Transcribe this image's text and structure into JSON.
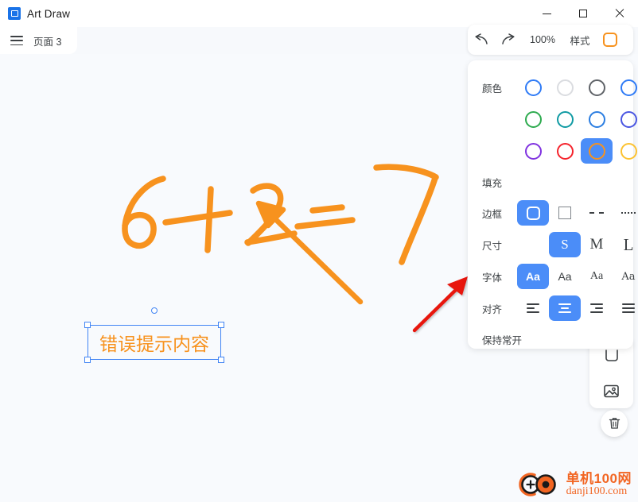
{
  "window": {
    "app_title": "Art Draw",
    "app_icon": "picture-icon",
    "controls": {
      "minimize": "minimize-icon",
      "maximize": "maximize-icon",
      "close": "close-icon"
    }
  },
  "tabbar": {
    "menu_icon": "hamburger-menu-icon",
    "tab_label": "页面 3"
  },
  "toolbar": {
    "undo_icon": "undo-arrow-icon",
    "redo_icon": "redo-arrow-icon",
    "zoom_level": "100%",
    "style_label": "样式",
    "style_swatch_color": "#f7921e"
  },
  "panel": {
    "color": {
      "label": "颜色",
      "swatches": [
        {
          "name": "blue",
          "hex": "#2f7bf6",
          "selected": false
        },
        {
          "name": "light-gray",
          "hex": "#dadce0",
          "selected": false
        },
        {
          "name": "dark-gray",
          "hex": "#5f6368",
          "selected": false
        },
        {
          "name": "royal-blue",
          "hex": "#2f7bf6",
          "selected": false
        },
        {
          "name": "green",
          "hex": "#2eab4f",
          "selected": false
        },
        {
          "name": "teal",
          "hex": "#0f9aa3",
          "selected": false
        },
        {
          "name": "azure",
          "hex": "#2a7de1",
          "selected": false
        },
        {
          "name": "indigo",
          "hex": "#4a56e2",
          "selected": false
        },
        {
          "name": "purple",
          "hex": "#8033e0",
          "selected": false
        },
        {
          "name": "red",
          "hex": "#f5232c",
          "selected": false
        },
        {
          "name": "orange",
          "hex": "#f7921e",
          "selected": true
        },
        {
          "name": "amber",
          "hex": "#fcc231",
          "selected": false
        }
      ],
      "selected_highlight": "#4b8df8"
    },
    "fill": {
      "label": "填充"
    },
    "border": {
      "label": "边框",
      "options": [
        {
          "name": "rounded-solid",
          "selected": true
        },
        {
          "name": "square-solid",
          "selected": false
        },
        {
          "name": "dashed",
          "selected": false
        },
        {
          "name": "dotted",
          "selected": false
        }
      ]
    },
    "size": {
      "label": "尺寸",
      "options": [
        {
          "name": "small",
          "text": "S",
          "selected": true
        },
        {
          "name": "medium",
          "text": "M",
          "selected": false
        },
        {
          "name": "large",
          "text": "L",
          "selected": false
        }
      ]
    },
    "font": {
      "label": "字体",
      "options": [
        {
          "name": "font-bold-sans",
          "text": "Aa",
          "selected": true
        },
        {
          "name": "font-sans",
          "text": "Aa",
          "selected": false
        },
        {
          "name": "font-serif",
          "text": "Aa",
          "selected": false
        },
        {
          "name": "font-slab",
          "text": "Aa",
          "selected": false
        }
      ]
    },
    "align": {
      "label": "对齐",
      "options": [
        {
          "name": "align-left",
          "selected": false
        },
        {
          "name": "align-center",
          "selected": true
        },
        {
          "name": "align-right",
          "selected": false
        },
        {
          "name": "align-justify",
          "selected": false
        }
      ]
    },
    "keep_open": {
      "label": "保持常开"
    }
  },
  "side_tools": {
    "shape_icon": "rounded-rect-icon",
    "image_icon": "image-icon",
    "delete_icon": "trash-icon"
  },
  "canvas": {
    "ink_color": "#f7921e",
    "handwriting_text": "6+2=7",
    "text_object": {
      "value": "错误提示内容",
      "text_color": "#f7921e",
      "selection_color": "#4285f4"
    },
    "annotation_arrow_color": "#e8130f"
  },
  "watermark": {
    "cn": "单机100网",
    "en": "danji100.com",
    "color": "#f26522"
  }
}
